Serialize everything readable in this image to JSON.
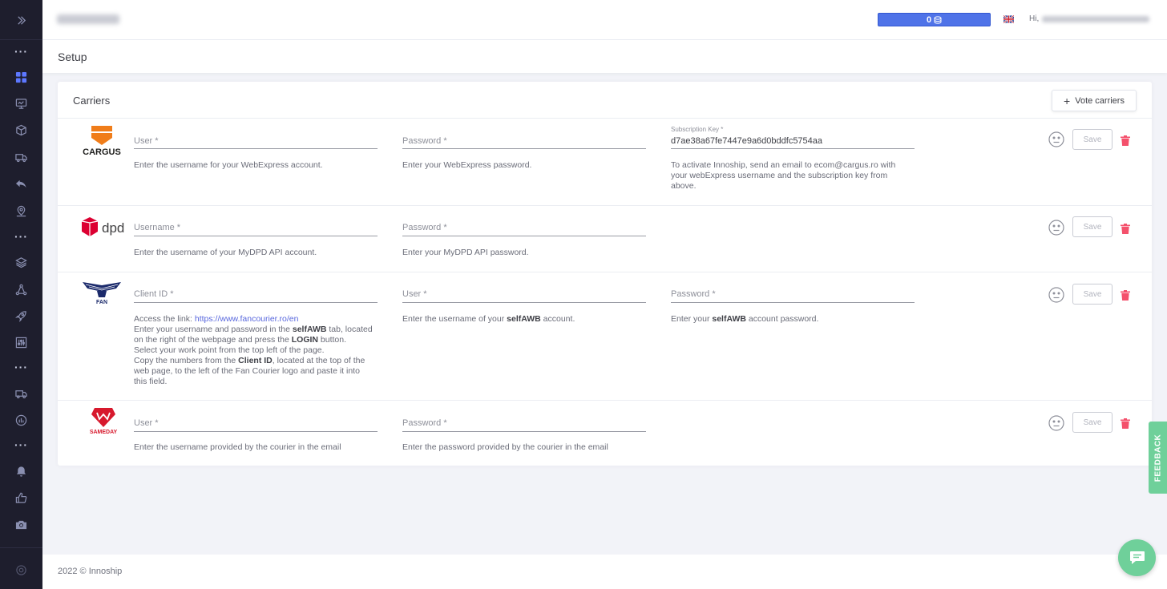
{
  "header": {
    "credits": "0",
    "greeting": "Hi,"
  },
  "page": {
    "title": "Setup"
  },
  "card": {
    "title": "Carriers",
    "vote_button": "Vote carriers"
  },
  "carriers": [
    {
      "name": "CARGUS",
      "fields": [
        {
          "label": "User *",
          "value": "",
          "help": "Enter the username for your WebExpress account."
        },
        {
          "label": "Password *",
          "value": "",
          "help": "Enter your WebExpress password."
        },
        {
          "label": "Subscription Key *",
          "value": "d7ae38a67fe7447e9a6d0bddfc5754aa",
          "help": "To activate Innoship, send an email to ecom@cargus.ro with your webExpress username and the subscription key from above."
        }
      ],
      "save": "Save"
    },
    {
      "name": "dpd",
      "fields": [
        {
          "label": "Username *",
          "value": "",
          "help": "Enter the username of your MyDPD API account."
        },
        {
          "label": "Password *",
          "value": "",
          "help": "Enter your MyDPD API password."
        }
      ],
      "save": "Save"
    },
    {
      "name": "FAN",
      "fields": [
        {
          "label": "Client ID *",
          "value": ""
        },
        {
          "label": "User *",
          "value": ""
        },
        {
          "label": "Password *",
          "value": ""
        }
      ],
      "help": {
        "link_prefix": "Access the link: ",
        "link": "https://www.fancourier.ro/en",
        "line2_a": "Enter your username and password in the ",
        "line2_b": "selfAWB",
        "line2_c": " tab, located on the right of the webpage and press the ",
        "line2_d": "LOGIN",
        "line2_e": " button.",
        "line3": "Select your work point from the top left of the page.",
        "line4_a": "Copy the numbers from the ",
        "line4_b": "Client ID",
        "line4_c": ", located at the top of the web page, to the left of the Fan Courier logo and paste it into this field.",
        "user_a": "Enter the username of your ",
        "user_b": "selfAWB",
        "user_c": " account.",
        "pass_a": "Enter your ",
        "pass_b": "selfAWB",
        "pass_c": " account password."
      },
      "save": "Save"
    },
    {
      "name": "SAMEDAY",
      "fields": [
        {
          "label": "User *",
          "value": "",
          "help": "Enter the username provided by the courier in the email"
        },
        {
          "label": "Password *",
          "value": "",
          "help": "Enter the password provided by the courier in the email"
        }
      ],
      "save": "Save"
    }
  ],
  "footer": {
    "text": "2022 ©  Innoship"
  },
  "feedback": "FEEDBACK",
  "colors": {
    "sidebar": "#1e1e2d",
    "accent": "#5d78ff",
    "credit": "#4f73e8",
    "delete": "#f4516c",
    "feedback": "#6fd09a"
  }
}
